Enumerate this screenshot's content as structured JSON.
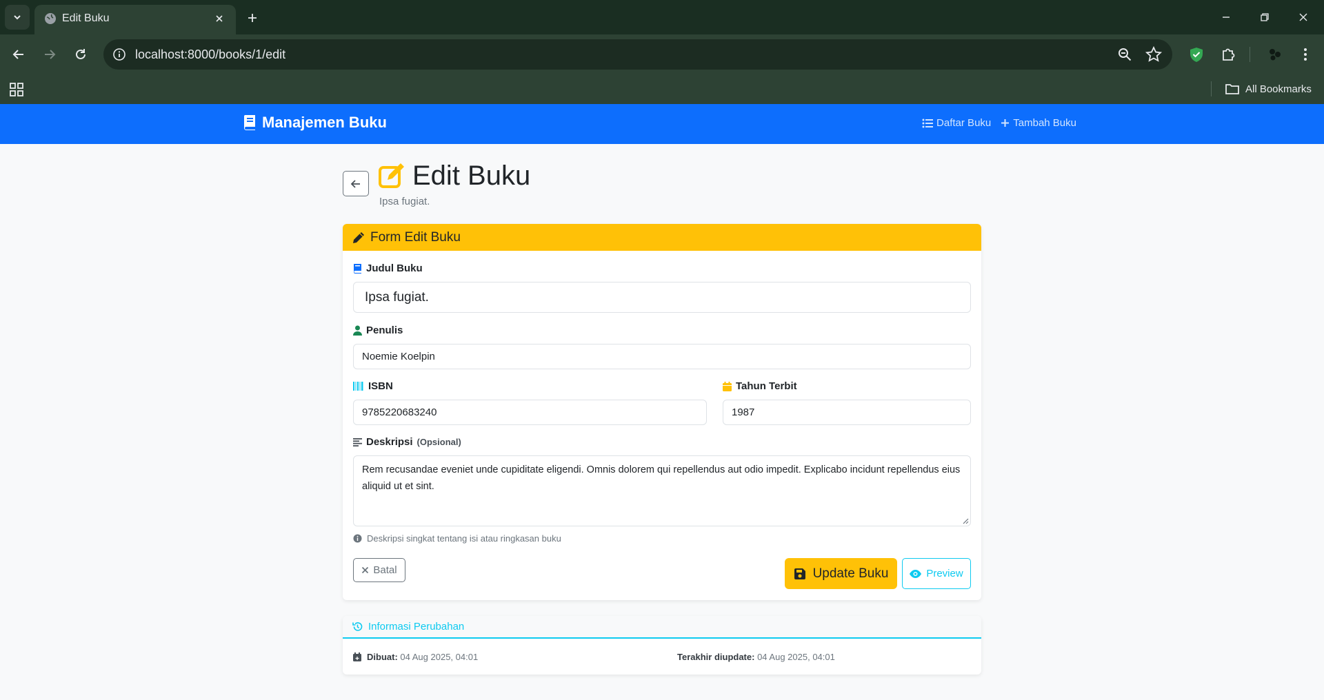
{
  "browser": {
    "tab_title": "Edit Buku",
    "url": "localhost:8000/books/1/edit",
    "all_bookmarks": "All Bookmarks"
  },
  "navbar": {
    "brand": "Manajemen Buku",
    "links": [
      {
        "label": "Daftar Buku"
      },
      {
        "label": "Tambah Buku"
      }
    ]
  },
  "page": {
    "title": "Edit Buku",
    "subtitle": "Ipsa fugiat."
  },
  "form": {
    "header": "Form Edit Buku",
    "judul_label": "Judul Buku",
    "judul_value": "Ipsa fugiat.",
    "penulis_label": "Penulis",
    "penulis_value": "Noemie Koelpin",
    "isbn_label": "ISBN",
    "isbn_value": "9785220683240",
    "tahun_label": "Tahun Terbit",
    "tahun_value": "1987",
    "deskripsi_label": "Deskripsi",
    "deskripsi_optional": "(Opsional)",
    "deskripsi_value": "Rem recusandae eveniet unde cupiditate eligendi. Omnis dolorem qui repellendus aut odio impedit. Explicabo incidunt repellendus eius aliquid ut et sint.",
    "deskripsi_help": "Deskripsi singkat tentang isi atau ringkasan buku",
    "batal_label": "Batal",
    "update_label": "Update Buku",
    "preview_label": "Preview"
  },
  "info": {
    "header": "Informasi Perubahan",
    "dibuat_label": "Dibuat:",
    "dibuat_value": "04 Aug 2025, 04:01",
    "diupdate_label": "Terakhir diupdate:",
    "diupdate_value": "04 Aug 2025, 04:01"
  },
  "colors": {
    "primary": "#0d6efd",
    "warning": "#ffc107",
    "info": "#0dcaf0",
    "success": "#198754",
    "secondary": "#6c757d"
  }
}
